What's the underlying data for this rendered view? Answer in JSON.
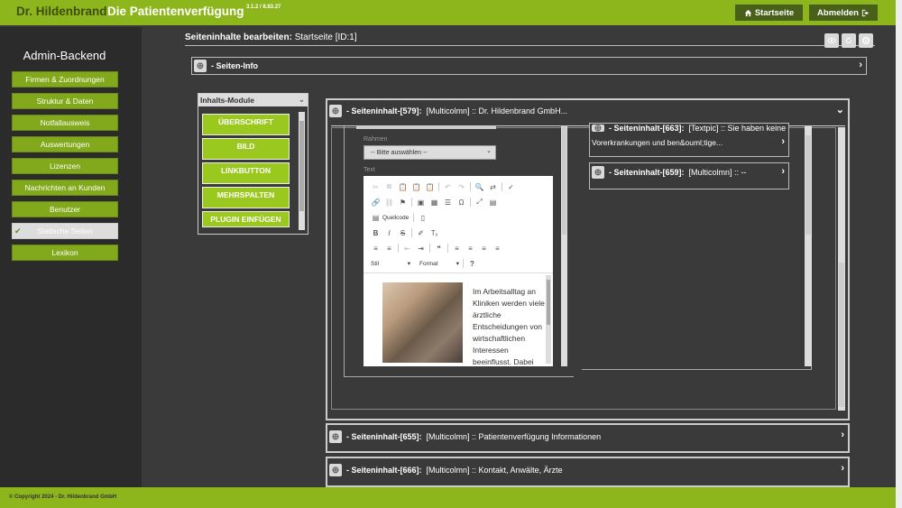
{
  "header": {
    "brand": "Dr. Hildenbrand",
    "subtitle": "Die Patientenverfügung",
    "version": "3.1.2 / 8.83.27",
    "home_button": "Startseite",
    "logout_button": "Abmelden"
  },
  "sidebar": {
    "title": "Admin-Backend",
    "items": [
      {
        "label": "Firmen & Zuordnungen"
      },
      {
        "label": "Struktur & Daten"
      },
      {
        "label": "Notfallausweis"
      },
      {
        "label": "Auswertungen"
      },
      {
        "label": "Lizenzen"
      },
      {
        "label": "Nachrichten an Kunden"
      },
      {
        "label": "Benutzer"
      },
      {
        "label": "Statische Seiten",
        "active": true
      },
      {
        "label": "Lexikon"
      }
    ]
  },
  "main": {
    "title_bold": "Seiteninhalte bearbeiten:",
    "title_rest": "Startseite [ID:1]",
    "seiten_info": "- Seiten-Info",
    "modules": {
      "title": "Inhalts-Module",
      "buttons": [
        "ÜBERSCHRIFT",
        "BILD",
        "LINKBUTTON",
        "MEHRSPALTEN",
        "PLUGIN EINFÜGEN"
      ]
    },
    "content_579": {
      "bold": "- Seiteninhalt-[579]:",
      "rest": "[Multicolmn]  ::  Dr.  Hildenbrand  GmbH..."
    },
    "rahmen_label": "Rahmen",
    "rahmen_select": "-- Bitte auswählen --",
    "text_label": "Text",
    "editor": {
      "source_label": "Quellcode",
      "style_label": "Stil",
      "format_label": "Format",
      "content_text": "Im Arbeitsalltag an Kliniken werden viele ärztliche Entscheidungen von wirtschaftlichen Interessen beeinflusst. Dabei"
    },
    "right_col": {
      "item_663_bold": "- Seiteninhalt-[663]:",
      "item_663_rest": "[Textpic]  ::  Sie  haben  keine",
      "item_663_line2": "Vorerkrankungen  und  ben&ouml;tige...",
      "item_659_bold": "- Seiteninhalt-[659]:",
      "item_659_rest": "[Multicolmn]  ::  --"
    },
    "content_655": {
      "bold": "- Seiteninhalt-[655]:",
      "rest": "[Multicolmn]  ::  Patientenverfügung  Informationen"
    },
    "content_666": {
      "bold": "- Seiteninhalt-[666]:",
      "rest": "[Multicolmn]  ::  Kontakt,  Anwälte,  Ärzte"
    }
  },
  "footer": {
    "copyright": "© Copyright 2024 - Dr. Hildenbrand GmbH"
  },
  "colors": {
    "accent": "#8db61c",
    "dark_button": "#49601a",
    "sidebar_bg": "#2b2b2b",
    "main_bg": "#3a3a3a"
  }
}
